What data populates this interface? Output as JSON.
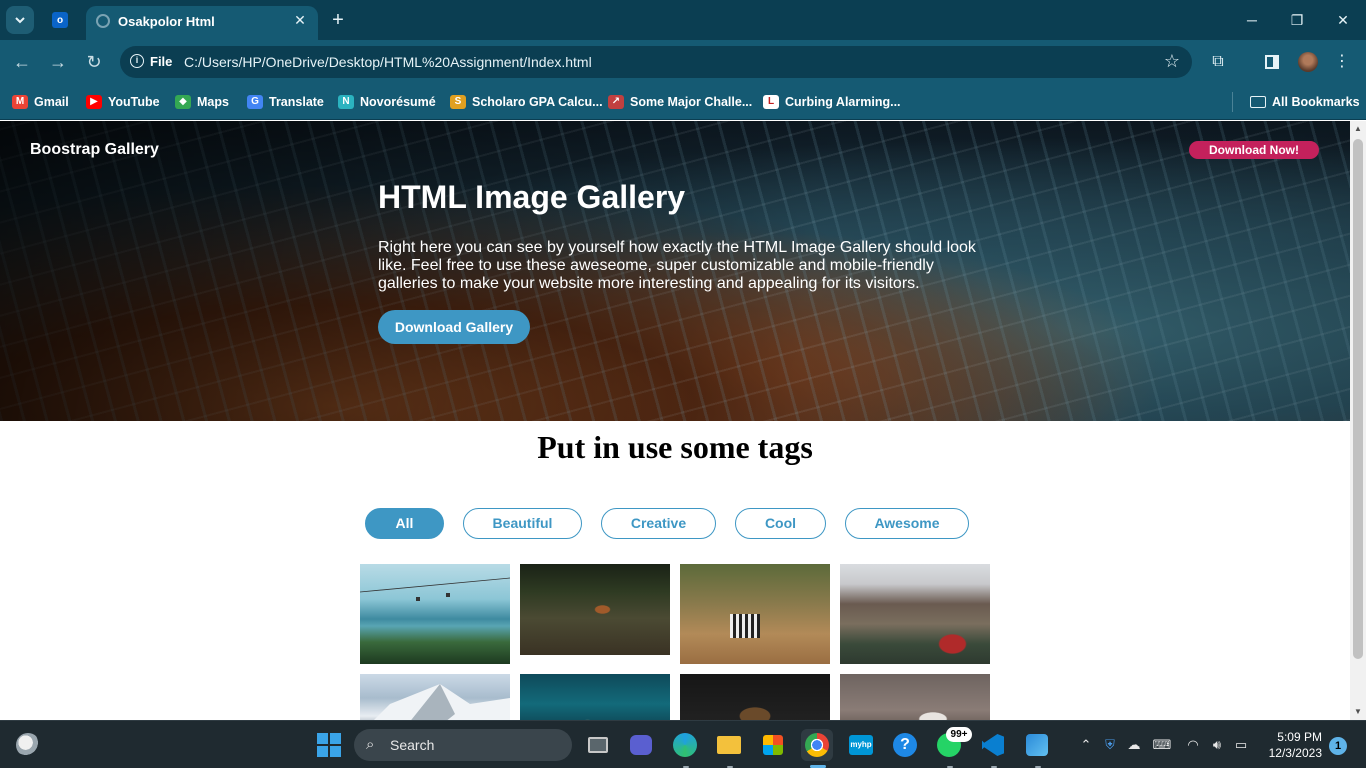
{
  "browser": {
    "tab_title": "Osakpolor Html",
    "file_label": "File",
    "url": "C:/Users/HP/OneDrive/Desktop/HTML%20Assignment/Index.html",
    "bookmarks": [
      {
        "label": "Gmail",
        "icon": "gmail-icon",
        "color": "#ea4335"
      },
      {
        "label": "YouTube",
        "icon": "youtube-icon",
        "color": "#ff0000"
      },
      {
        "label": "Maps",
        "icon": "maps-icon",
        "color": "#34a853"
      },
      {
        "label": "Translate",
        "icon": "translate-icon",
        "color": "#4285f4"
      },
      {
        "label": "Novorésumé",
        "icon": "novoresume-icon",
        "color": "#2bb3c0"
      },
      {
        "label": "Scholaro GPA Calcu...",
        "icon": "scholaro-icon",
        "color": "#e0a020"
      },
      {
        "label": "Some Major Challe...",
        "icon": "page-icon",
        "color": "#c04040"
      },
      {
        "label": "Curbing Alarming...",
        "icon": "page-icon",
        "color": "#c02020"
      }
    ],
    "all_bookmarks_label": "All Bookmarks"
  },
  "page": {
    "brand": "Boostrap Gallery",
    "download_now": "Download Now!",
    "hero_title": "HTML Image Gallery",
    "hero_text": "Right here you can see by yourself how exactly the HTML Image Gallery should look like. Feel free to use these aweseome, super customizable and mobile-friendly galleries to make your website more interesting and appealing for its visitors.",
    "download_gallery": "Download Gallery",
    "section_title": "Put in use some tags",
    "filters": [
      "All",
      "Beautiful",
      "Creative",
      "Cool",
      "Awesome"
    ],
    "active_filter": "All",
    "accent_color": "#3e97c4",
    "cta_color": "#c4215c",
    "images": [
      "coastal-landscape",
      "fox-in-forest",
      "zebra-savanna",
      "mountain-village",
      "snowy-peak",
      "underwater-hand",
      "owl-dark",
      "bird-on-branch"
    ]
  },
  "taskbar": {
    "search_label": "Search",
    "whatsapp_badge": "99+",
    "time": "5:09 PM",
    "date": "12/3/2023",
    "notifications": "1"
  }
}
